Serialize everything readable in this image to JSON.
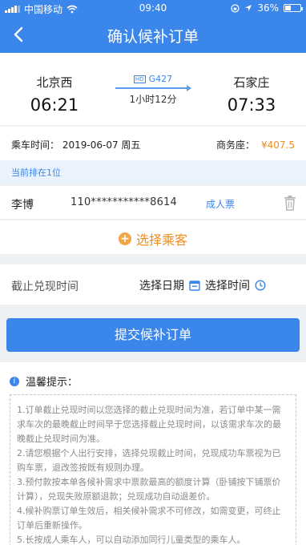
{
  "statusbar": {
    "carrier": "中国移动",
    "time": "09:40",
    "battery": "36%"
  },
  "nav": {
    "title": "确认候补订单"
  },
  "trip": {
    "from": {
      "station": "北京西",
      "time": "06:21"
    },
    "to": {
      "station": "石家庄",
      "time": "07:33"
    },
    "train": "G427",
    "train_tag": "HD",
    "duration": "1小时12分"
  },
  "ride_info": {
    "date_label": "乘车时间：",
    "date_value": "2019-06-07 周五",
    "seat_label": "商务座：",
    "price": "¥407.5"
  },
  "queue_text": "当前排在1位",
  "passenger": {
    "name": "李博",
    "id_number": "110***********8614",
    "type": "成人票"
  },
  "add_passenger_label": "选择乘客",
  "deadline": {
    "label": "截止兑现时间",
    "date_label": "选择日期",
    "time_label": "选择时间"
  },
  "submit_label": "提交候补订单",
  "notice": {
    "title": "温馨提示：",
    "lines": [
      "1.订单截止兑现时间以您选择的截止兑现时间为准，若订单中某一需求车次的最晚截止时间早于您选择截止兑现时间，以该需求车次的最晚截止兑现时间为准。",
      "2.请您根据个人出行安排，选择兑现截止时间，兑现成功车票视为已购车票，退改签按既有规则办理。",
      "3.预付款按本单各候补需求中票款最高的额度计算（卧铺按下铺票价计算），兑现失败原额退款；兑现成功自动退差价。",
      "4.候补购票订单生效后，相关候补需求不可修改，如需变更，可终止订单后重新操作。",
      "5.长按成人乘车人，可以自动添加同行儿童类型的乘车人。"
    ]
  },
  "colors": {
    "primary": "#3b86ea",
    "accent": "#f08c1e"
  }
}
